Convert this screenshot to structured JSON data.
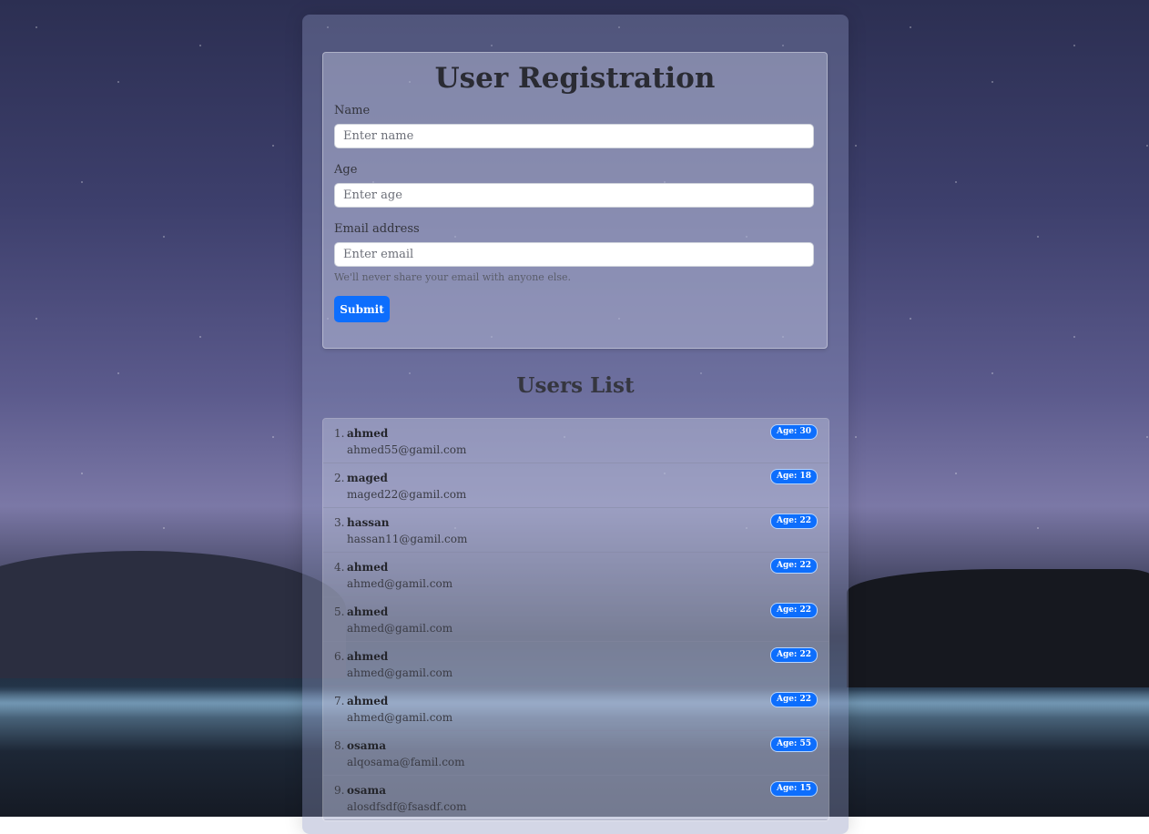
{
  "form": {
    "title": "User Registration",
    "name_label": "Name",
    "name_placeholder": "Enter name",
    "age_label": "Age",
    "age_placeholder": "Enter age",
    "email_label": "Email address",
    "email_placeholder": "Enter email",
    "email_help": "We'll never share your email with anyone else.",
    "submit_label": "Submit"
  },
  "users": {
    "title": "Users List",
    "items": [
      {
        "num": "1.",
        "name": "ahmed",
        "email": "ahmed55@gamil.com",
        "age": "Age: 30"
      },
      {
        "num": "2.",
        "name": "maged",
        "email": "maged22@gamil.com",
        "age": "Age: 18"
      },
      {
        "num": "3.",
        "name": "hassan",
        "email": "hassan11@gamil.com",
        "age": "Age: 22"
      },
      {
        "num": "4.",
        "name": "ahmed",
        "email": "ahmed@gamil.com",
        "age": "Age: 22"
      },
      {
        "num": "5.",
        "name": "ahmed",
        "email": "ahmed@gamil.com",
        "age": "Age: 22"
      },
      {
        "num": "6.",
        "name": "ahmed",
        "email": "ahmed@gamil.com",
        "age": "Age: 22"
      },
      {
        "num": "7.",
        "name": "ahmed",
        "email": "ahmed@gamil.com",
        "age": "Age: 22"
      },
      {
        "num": "8.",
        "name": "osama",
        "email": "alqosama@famil.com",
        "age": "Age: 55"
      },
      {
        "num": "9.",
        "name": "osama",
        "email": "alosdfsdf@fsasdf.com",
        "age": "Age: 15"
      }
    ]
  },
  "colors": {
    "primary": "#0d6efd"
  }
}
